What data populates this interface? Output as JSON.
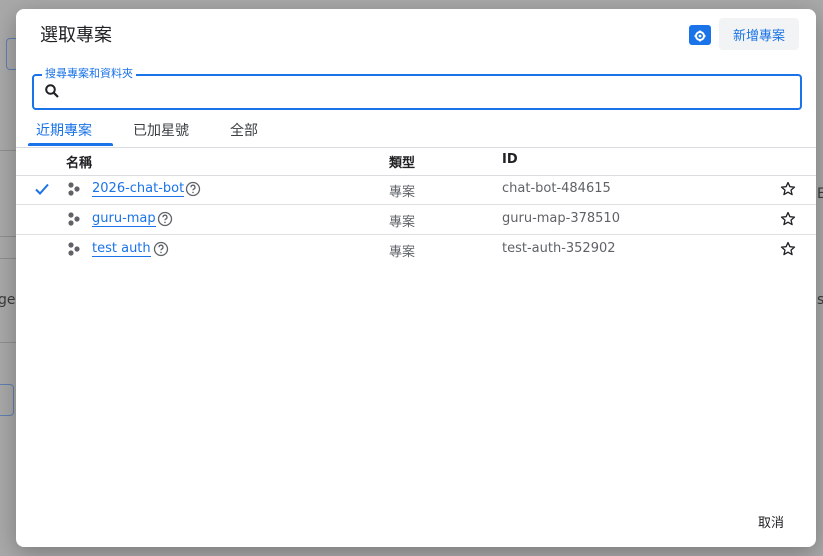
{
  "backdrop": {
    "left_text": "ge",
    "right_text_1": "Ei",
    "right_text_2": "s"
  },
  "dialog": {
    "title": "選取專案",
    "new_project_label": "新增專案",
    "search": {
      "label": "搜尋專案和資料夾",
      "value": ""
    },
    "tabs": [
      {
        "label": "近期專案",
        "active": true
      },
      {
        "label": "已加星號",
        "active": false
      },
      {
        "label": "全部",
        "active": false
      }
    ],
    "columns": {
      "name": "名稱",
      "type": "類型",
      "id": "ID"
    },
    "rows": [
      {
        "selected": true,
        "name": "2026-chat-bot",
        "type": "專案",
        "id": "chat-bot-484615"
      },
      {
        "selected": false,
        "name": "guru-map",
        "type": "專案",
        "id": "guru-map-378510"
      },
      {
        "selected": false,
        "name": "test auth",
        "type": "專案",
        "id": "test-auth-352902"
      }
    ],
    "cancel_label": "取消"
  },
  "colors": {
    "accent": "#1a73e8",
    "backdrop": "#a9a9a9"
  }
}
